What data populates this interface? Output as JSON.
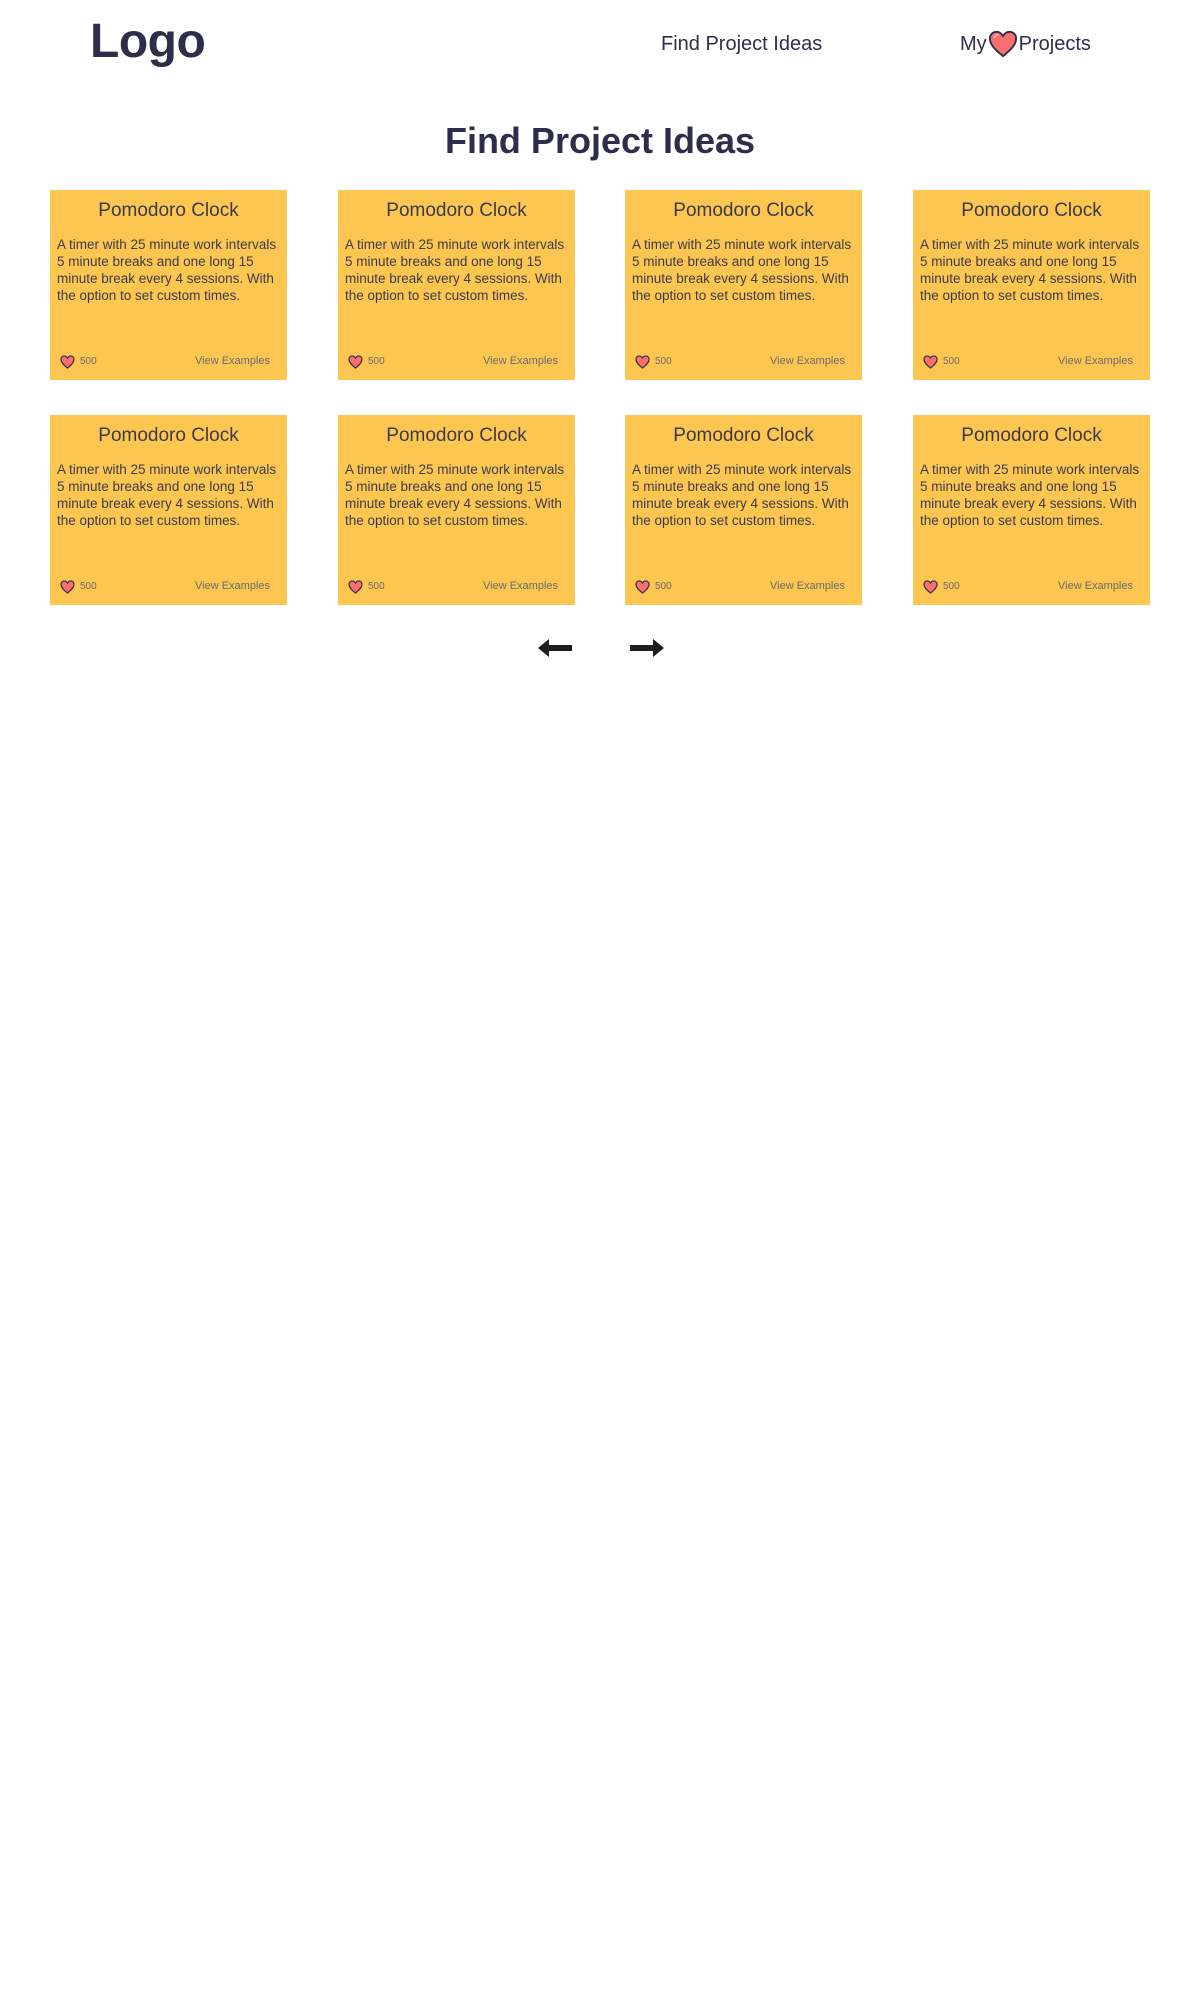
{
  "header": {
    "logo": "Logo",
    "nav_find": "Find Project Ideas",
    "nav_my_prefix": "My",
    "nav_my_suffix": "Projects",
    "heart_icon": "heart-icon"
  },
  "main": {
    "title": "Find Project Ideas"
  },
  "cards": [
    {
      "title": "Pomodoro Clock",
      "description": "A timer with 25 minute work intervals 5 minute breaks and one long 15 minute break every 4 sessions. With the option to set custom times.",
      "likes": "500",
      "link": "View Examples"
    },
    {
      "title": "Pomodoro Clock",
      "description": "A timer with 25 minute work intervals 5 minute breaks and one long 15 minute break every 4 sessions. With the option to set custom times.",
      "likes": "500",
      "link": "View Examples"
    },
    {
      "title": "Pomodoro Clock",
      "description": "A timer with 25 minute work intervals 5 minute breaks and one long 15 minute break every 4 sessions. With the option to set custom times.",
      "likes": "500",
      "link": "View Examples"
    },
    {
      "title": "Pomodoro Clock",
      "description": "A timer with 25 minute work intervals 5 minute breaks and one long 15 minute break every 4 sessions. With the option to set custom times.",
      "likes": "500",
      "link": "View Examples"
    },
    {
      "title": "Pomodoro Clock",
      "description": "A timer with 25 minute work intervals 5 minute breaks and one long 15 minute break every 4 sessions. With the option to set custom times.",
      "likes": "500",
      "link": "View Examples"
    },
    {
      "title": "Pomodoro Clock",
      "description": "A timer with 25 minute work intervals 5 minute breaks and one long 15 minute break every 4 sessions. With the option to set custom times.",
      "likes": "500",
      "link": "View Examples"
    },
    {
      "title": "Pomodoro Clock",
      "description": "A timer with 25 minute work intervals 5 minute breaks and one long 15 minute break every 4 sessions. With the option to set custom times.",
      "likes": "500",
      "link": "View Examples"
    },
    {
      "title": "Pomodoro Clock",
      "description": "A timer with 25 minute work intervals 5 minute breaks and one long 15 minute break every 4 sessions. With the option to set custom times.",
      "likes": "500",
      "link": "View Examples"
    }
  ],
  "pagination": {
    "prev_icon": "arrow-left-icon",
    "next_icon": "arrow-right-icon"
  },
  "colors": {
    "card_bg": "#fdc651",
    "heading": "#2f2e4a",
    "heart": "#fa6f6f"
  }
}
